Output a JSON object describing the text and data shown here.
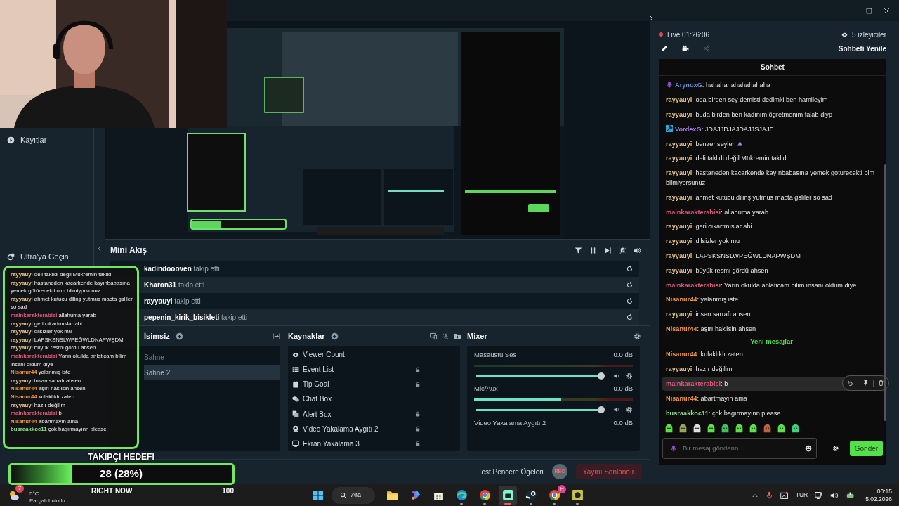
{
  "sidebar": {
    "items": [
      {
        "label": "Kayıtlar",
        "kind": "recordings"
      },
      {
        "label": "Ultra'ya Geçin",
        "kind": "ultra"
      }
    ]
  },
  "mini_feed": {
    "title": "Mini Akış",
    "events": [
      {
        "name": "kadindoooven",
        "action": "takip etti"
      },
      {
        "name": "Kharon31",
        "action": "takip etti"
      },
      {
        "name": "rayyauyi",
        "action": "takip etti"
      },
      {
        "name": "pepenin_kirik_bisikleti",
        "action": "takip etti"
      }
    ]
  },
  "scenes": {
    "title": "İsimsiz",
    "items": [
      {
        "label": "Sahne",
        "selected": false
      },
      {
        "label": "Sahne 2",
        "selected": true
      }
    ]
  },
  "sources": {
    "title": "Kaynaklar",
    "items": [
      {
        "label": "Viewer Count",
        "kind": "viewer_count",
        "locked": false
      },
      {
        "label": "Event List",
        "kind": "event_list",
        "locked": true
      },
      {
        "label": "Tip Goal",
        "kind": "tip_goal",
        "locked": true
      },
      {
        "label": "Chat Box",
        "kind": "chat_box",
        "locked": false
      },
      {
        "label": "Alert Box",
        "kind": "alert_box",
        "locked": true
      },
      {
        "label": "Video Yakalama Aygıtı 2",
        "kind": "video_capture",
        "locked": true
      },
      {
        "label": "Ekran Yakalama 3",
        "kind": "screen_capture",
        "locked": true
      }
    ]
  },
  "mixer": {
    "title": "Mixer",
    "channels": [
      {
        "name": "Masaüstü Ses",
        "reading": "0.0 dB",
        "volume": {
          "level": 0.97
        }
      },
      {
        "name": "Mic/Aux",
        "reading": "0.0 dB",
        "meter": {
          "level": 0.55
        },
        "volume": {
          "level": 0.97
        }
      },
      {
        "name": "Video Yakalama Aygıtı 2",
        "reading": "0.0 dB"
      }
    ]
  },
  "footer": {
    "test_widgets": "Test Pencere Öğeleri",
    "rec": "REC",
    "end_stream": "Yayını Sonlandır"
  },
  "stream_info": {
    "status": "Live",
    "duration": "01:26:06",
    "viewers": "5 izleyiciler",
    "refresh_chat": "Sohbeti Yenile"
  },
  "chat": {
    "title": "Sohbet",
    "messages": [
      {
        "kind": "mic",
        "user": "ArynoxG",
        "color": "#6b8fe0",
        "text": ": hahahahahahahahaha",
        "hovered": false
      },
      {
        "kind": "plain",
        "user": "rayyauyi",
        "color": "#e6c58e",
        "text": ": oda birden sey demisti dedimki ben hamileyim",
        "hovered": false
      },
      {
        "kind": "plain",
        "user": "rayyauyi",
        "color": "#e6c58e",
        "text": ": buda birden ben kadınım ögretmenim falab diyp",
        "hovered": false
      },
      {
        "kind": "hammer",
        "user": "VordexG",
        "color": "#a77be6",
        "text": ": JDAJJDJAJDAJJSJAJE",
        "hovered": false
      },
      {
        "kind": "plain",
        "user": "rayyauyi",
        "color": "#e6c58e",
        "text": ": benzer seyler",
        "emote": true,
        "hovered": false
      },
      {
        "kind": "plain",
        "user": "rayyauyi",
        "color": "#e6c58e",
        "text": ": deli taklidi değil Mükremin taklidi",
        "hovered": false
      },
      {
        "kind": "plain",
        "user": "rayyauyi",
        "color": "#e6c58e",
        "text": ": hastaneden kacarkende kayınbabasına yemek götürecekti olm bilmiyprsunuz",
        "hovered": false
      },
      {
        "kind": "plain",
        "user": "rayyauyi",
        "color": "#e6c58e",
        "text": ": ahmet kutucu dilinş yutmus macta gsliler so sad",
        "hovered": false
      },
      {
        "kind": "plain",
        "user": "mainkarakterabisi",
        "color": "#e0567f",
        "text": ": allahuma yarab",
        "hovered": false
      },
      {
        "kind": "plain",
        "user": "rayyauyi",
        "color": "#e6c58e",
        "text": ": geri cıkartmıslar abi",
        "hovered": false
      },
      {
        "kind": "plain",
        "user": "rayyauyi",
        "color": "#e6c58e",
        "text": ": dilsizler yok mu",
        "hovered": false
      },
      {
        "kind": "plain",
        "user": "rayyauyi",
        "color": "#e6c58e",
        "text": ": LAPSKSNSLWPEĞWLDNAPWŞDM",
        "hovered": false
      },
      {
        "kind": "plain",
        "user": "rayyauyi",
        "color": "#e6c58e",
        "text": ": büyük resmi gördü ahsen",
        "hovered": false
      },
      {
        "kind": "plain",
        "user": "mainkarakterabisi",
        "color": "#e0567f",
        "text": ": Yarın okulda anlaticam bilim insanı oldum diye",
        "hovered": false
      },
      {
        "kind": "plain",
        "user": "Nisanur44",
        "color": "#ee9440",
        "text": ": yalanmış iste",
        "hovered": false
      },
      {
        "kind": "plain",
        "user": "rayyauyi",
        "color": "#e6c58e",
        "text": ": insan sarrafı ahsen",
        "hovered": false
      },
      {
        "kind": "plain",
        "user": "Nisanur44",
        "color": "#ee9440",
        "text": ": aşırı haklisin ahsen",
        "hovered": false
      }
    ],
    "new_divider": "Yeni mesajlar",
    "new_messages": [
      {
        "kind": "plain",
        "user": "Nisanur44",
        "color": "#ee9440",
        "text": ": kulaklıklı zaten",
        "hovered": false
      },
      {
        "kind": "plain",
        "user": "rayyauyi",
        "color": "#e6c58e",
        "text": ": hazır değilim",
        "hovered": false
      },
      {
        "kind": "plain",
        "user": "mainkarakterabisi",
        "color": "#e0567f",
        "text": ": b",
        "hovered": true
      },
      {
        "kind": "plain",
        "user": "Nisanur44",
        "color": "#ee9440",
        "text": ": abartmayın ama",
        "hovered": false
      },
      {
        "kind": "plain",
        "user": "busraakkoc11",
        "color": "#8fe08f",
        "text": ": çok bagırmayınn please",
        "hovered": false
      }
    ],
    "input": {
      "placeholder": "Bir mesaj gönderin"
    },
    "send": "Gönder"
  },
  "overlay_chat": {
    "messages": [
      {
        "user": "rayyauyi",
        "color": "#e6c58e",
        "text": "deli taklidi değil Mükremin taklidi"
      },
      {
        "user": "rayyauyi",
        "color": "#e6c58e",
        "text": "hastaneden kacarkende kayınbabasına yemek götürecekti olm bilmiyprsunuz"
      },
      {
        "user": "rayyauyi",
        "color": "#e6c58e",
        "text": "ahmet kutucu dilinş yutmus macta gsliler so sad"
      },
      {
        "user": "mainkarakterabisi",
        "color": "#e0567f",
        "text": "allahuma yarab"
      },
      {
        "user": "rayyauyi",
        "color": "#e6c58e",
        "text": "geri cıkartmıslar abi"
      },
      {
        "user": "rayyauyi",
        "color": "#e6c58e",
        "text": "dilsizler yok mu"
      },
      {
        "user": "rayyauyi",
        "color": "#e6c58e",
        "text": "LAPSKSNSLWPEĞWLDNAPWŞDM"
      },
      {
        "user": "rayyauyi",
        "color": "#e6c58e",
        "text": "büyük resmi gördü ahsen"
      },
      {
        "user": "mainkarakterabisi",
        "color": "#e0567f",
        "text": "Yarın okulda anlaticam bilim insanı oldum diye"
      },
      {
        "user": "Nisanur44",
        "color": "#ee9440",
        "text": "yalanmış iste"
      },
      {
        "user": "rayyauyi",
        "color": "#e6c58e",
        "text": "insan sarrafı ahsen"
      },
      {
        "user": "Nisanur44",
        "color": "#ee9440",
        "text": "aşırı haklisin ahsen"
      },
      {
        "user": "Nisanur44",
        "color": "#ee9440",
        "text": "kulaklıklı zaten"
      },
      {
        "user": "rayyauyi",
        "color": "#e6c58e",
        "text": "hazır değilim"
      },
      {
        "user": "mainkarakterabisi",
        "color": "#e0567f",
        "text": "b"
      },
      {
        "user": "Nisanur44",
        "color": "#ee9440",
        "text": "abartmayın ama"
      },
      {
        "user": "busraakkoc11",
        "color": "#8fe08f",
        "text": "çok bagırmayınn please"
      }
    ]
  },
  "follower_goal": {
    "title": "TAKIPÇI HEDEFI",
    "value": "28 (28%)",
    "level": 0.28,
    "left_label": "RIGHT NOW",
    "right_label": "100"
  },
  "taskbar": {
    "weather": {
      "temperature": "5°C",
      "condition": "Parçalı bulutlu",
      "badge": "7"
    },
    "search": "Ara",
    "apps": [
      {
        "kind": "files",
        "running": false,
        "active": false
      },
      {
        "kind": "copilot",
        "running": false,
        "active": false
      },
      {
        "kind": "store",
        "running": false,
        "active": false
      },
      {
        "kind": "edge",
        "running": true,
        "active": false
      },
      {
        "kind": "chrome",
        "running": true,
        "active": false
      },
      {
        "kind": "streamlabs",
        "running": true,
        "active": true
      },
      {
        "kind": "steam",
        "running": true,
        "active": false
      },
      {
        "kind": "chrome",
        "running": true,
        "active": false,
        "badge": "H"
      },
      {
        "kind": "app",
        "running": true,
        "active": false
      }
    ],
    "tray": {
      "language": "TUR",
      "time": "00:15",
      "date": "5.02.2026"
    }
  }
}
